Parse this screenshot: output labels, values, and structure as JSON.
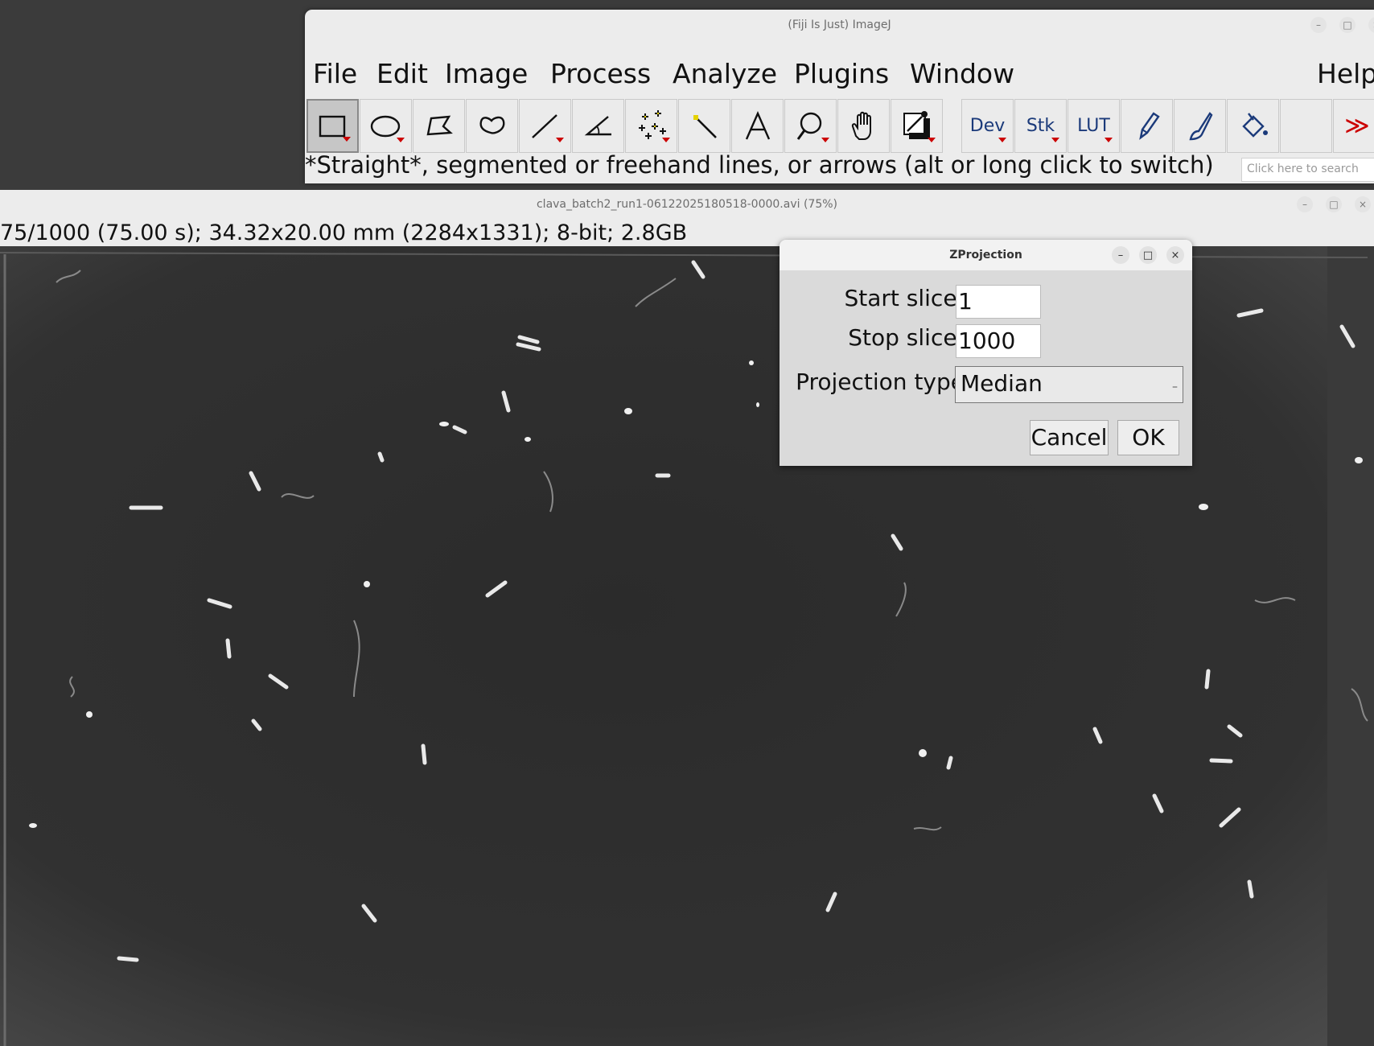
{
  "main_window": {
    "title": "(Fiji Is Just) ImageJ",
    "menu": [
      "File",
      "Edit",
      "Image",
      "Process",
      "Analyze",
      "Plugins",
      "Window",
      "Help"
    ],
    "toolbar": {
      "tools": [
        "rectangle-tool-icon",
        "oval-tool-icon",
        "polygon-tool-icon",
        "freehand-tool-icon",
        "line-tool-icon",
        "angle-tool-icon",
        "multipoint-tool-icon",
        "wand-tool-icon",
        "text-tool-icon",
        "magnifier-tool-icon",
        "hand-tool-icon",
        "color-picker-icon"
      ],
      "dev_label": "Dev",
      "stk_label": "Stk",
      "lut_label": "LUT",
      "more_label": "≫"
    },
    "status": "*Straight*, segmented or freehand lines, or arrows (alt or long click to switch)",
    "search_placeholder": "Click here to search"
  },
  "image_window": {
    "title": "clava_batch2_run1-06122025180518-0000.avi (75%)",
    "info": "75/1000 (75.00 s); 34.32x20.00 mm (2284x1331); 8-bit; 2.8GB"
  },
  "zprojection": {
    "title": "ZProjection",
    "start_label": "Start slice:",
    "start_value": "1",
    "stop_label": "Stop slice:",
    "stop_value": "1000",
    "type_label": "Projection type",
    "type_value": "Median",
    "cancel_label": "Cancel",
    "ok_label": "OK"
  },
  "colors": {
    "accent_red": "#cc0000",
    "toolbar_text_blue": "#1b3a7a",
    "image_background": "#2d2d2d"
  }
}
